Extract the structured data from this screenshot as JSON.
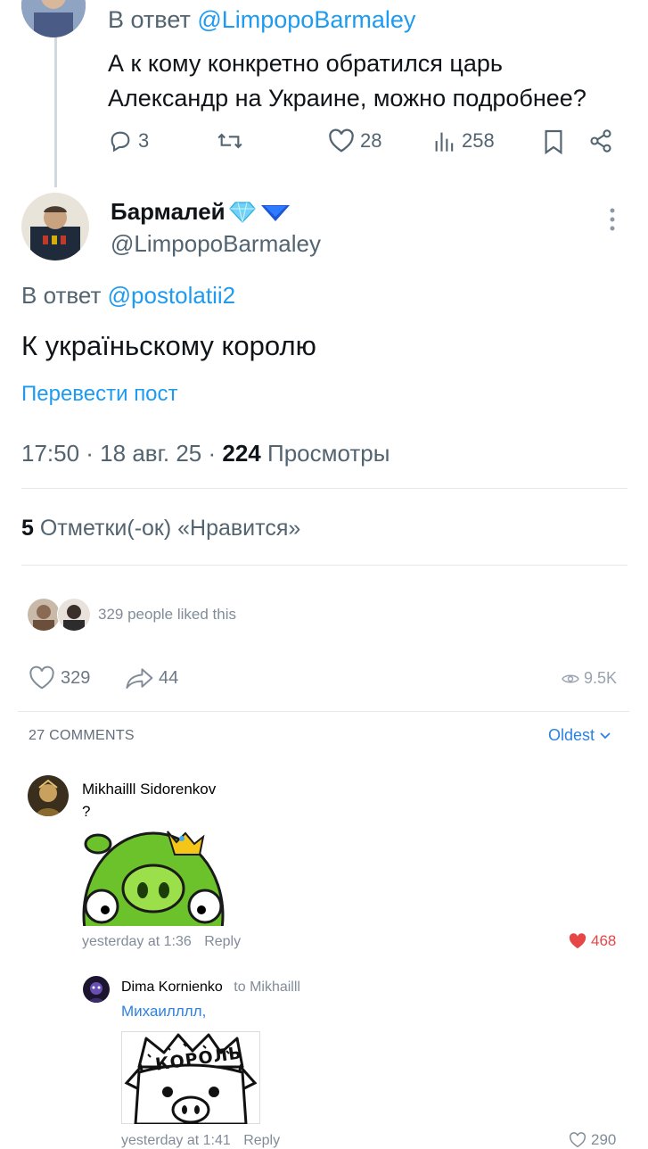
{
  "prev_tweet": {
    "reply_prefix": "В ответ",
    "reply_handle": "@LimpopoBarmaley",
    "text_line1": "А к кому конкретно обратился царь",
    "text_line2": "Александр на Украине, можно подробнее?",
    "replies": "3",
    "likes": "28",
    "views": "258"
  },
  "main_tweet": {
    "display_name": "Бармалей",
    "handle": "@LimpopoBarmaley",
    "reply_prefix": "В ответ",
    "reply_handle": "@postolatii2",
    "text": "К україньскому королю",
    "translate": "Перевести пост",
    "time_date": "17:50 · 18 авг. 25 ·",
    "views_count": "224",
    "views_label": "Просмотры",
    "likes_count": "5",
    "likes_label": "Отметки(-ок) «Нравится»"
  },
  "vk_post": {
    "liked_text": "329 people liked this",
    "likes": "329",
    "shares": "44",
    "views": "9.5K",
    "comments_header": "27 COMMENTS",
    "sort_label": "Oldest"
  },
  "comments": [
    {
      "author": "Mikhailll Sidorenkov",
      "text": "?",
      "time": "yesterday at 1:36",
      "reply_label": "Reply",
      "likes": "468"
    },
    {
      "author": "Dima Kornienko",
      "to": "to Mikhailll",
      "addressee": "Михаилллл,",
      "sticker_text": "КОРОЛЬ",
      "time": "yesterday at 1:41",
      "reply_label": "Reply",
      "likes": "290"
    }
  ],
  "colors": {
    "twitter_blue": "#1d9bf0",
    "muted": "#536471",
    "vk_heart": "#e64646",
    "pig_green": "#6cc22a"
  }
}
